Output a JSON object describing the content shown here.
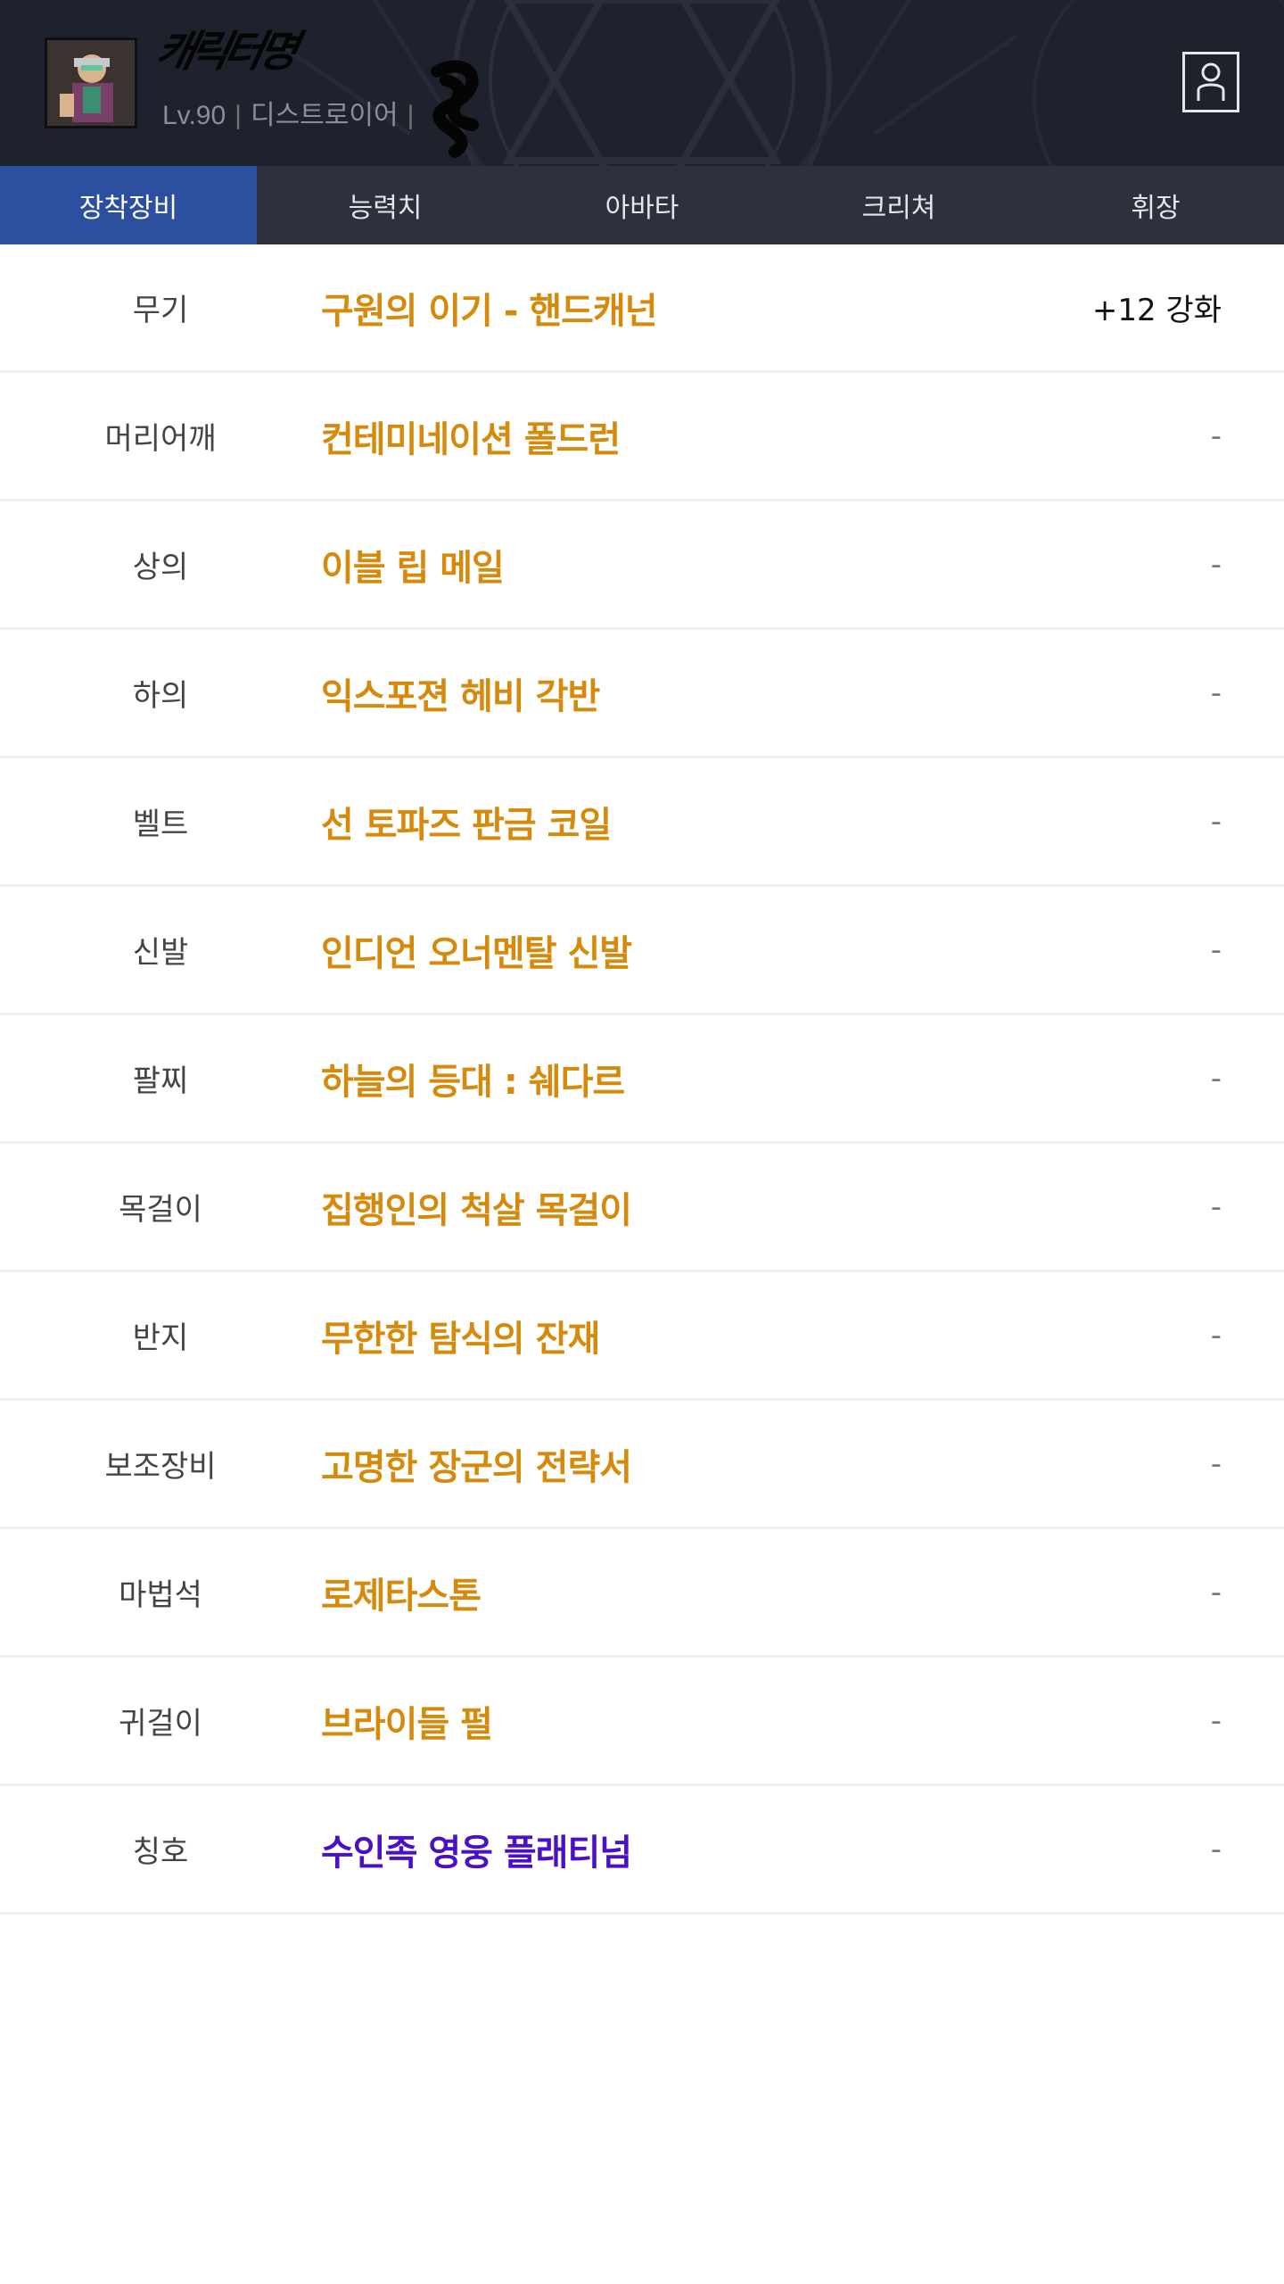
{
  "header": {
    "character_name": "캐릭터명",
    "level": "Lv.90",
    "job": "디스트로이어",
    "separator": "|",
    "profile_icon": "user-icon"
  },
  "tabs": [
    {
      "label": "장착장비",
      "active": true
    },
    {
      "label": "능력치",
      "active": false
    },
    {
      "label": "아바타",
      "active": false
    },
    {
      "label": "크리쳐",
      "active": false
    },
    {
      "label": "휘장",
      "active": false
    }
  ],
  "equipment": [
    {
      "slot": "무기",
      "item": "구원의 이기 - 핸드캐넌",
      "extra": "+12 강화",
      "rarity": "unique"
    },
    {
      "slot": "머리어깨",
      "item": "컨테미네이션 폴드런",
      "extra": "-",
      "rarity": "unique"
    },
    {
      "slot": "상의",
      "item": "이블 립 메일",
      "extra": "-",
      "rarity": "unique"
    },
    {
      "slot": "하의",
      "item": "익스포젼 헤비 각반",
      "extra": "-",
      "rarity": "unique"
    },
    {
      "slot": "벨트",
      "item": "선 토파즈 판금 코일",
      "extra": "-",
      "rarity": "unique"
    },
    {
      "slot": "신발",
      "item": "인디언 오너멘탈 신발",
      "extra": "-",
      "rarity": "unique"
    },
    {
      "slot": "팔찌",
      "item": "하늘의 등대 : 쉐다르",
      "extra": "-",
      "rarity": "unique"
    },
    {
      "slot": "목걸이",
      "item": "집행인의 척살 목걸이",
      "extra": "-",
      "rarity": "unique"
    },
    {
      "slot": "반지",
      "item": "무한한 탐식의 잔재",
      "extra": "-",
      "rarity": "unique"
    },
    {
      "slot": "보조장비",
      "item": "고명한 장군의 전략서",
      "extra": "-",
      "rarity": "unique"
    },
    {
      "slot": "마법석",
      "item": "로제타스톤",
      "extra": "-",
      "rarity": "unique"
    },
    {
      "slot": "귀걸이",
      "item": "브라이들 펄",
      "extra": "-",
      "rarity": "unique"
    },
    {
      "slot": "칭호",
      "item": "수인족 영웅 플래티넘",
      "extra": "-",
      "rarity": "rare"
    }
  ],
  "colors": {
    "header_bg": "#1e222c",
    "tab_bg": "#2c313d",
    "tab_active": "#2c4fa0",
    "unique_item": "#d68a0c",
    "rare_item": "#4a10c6"
  }
}
